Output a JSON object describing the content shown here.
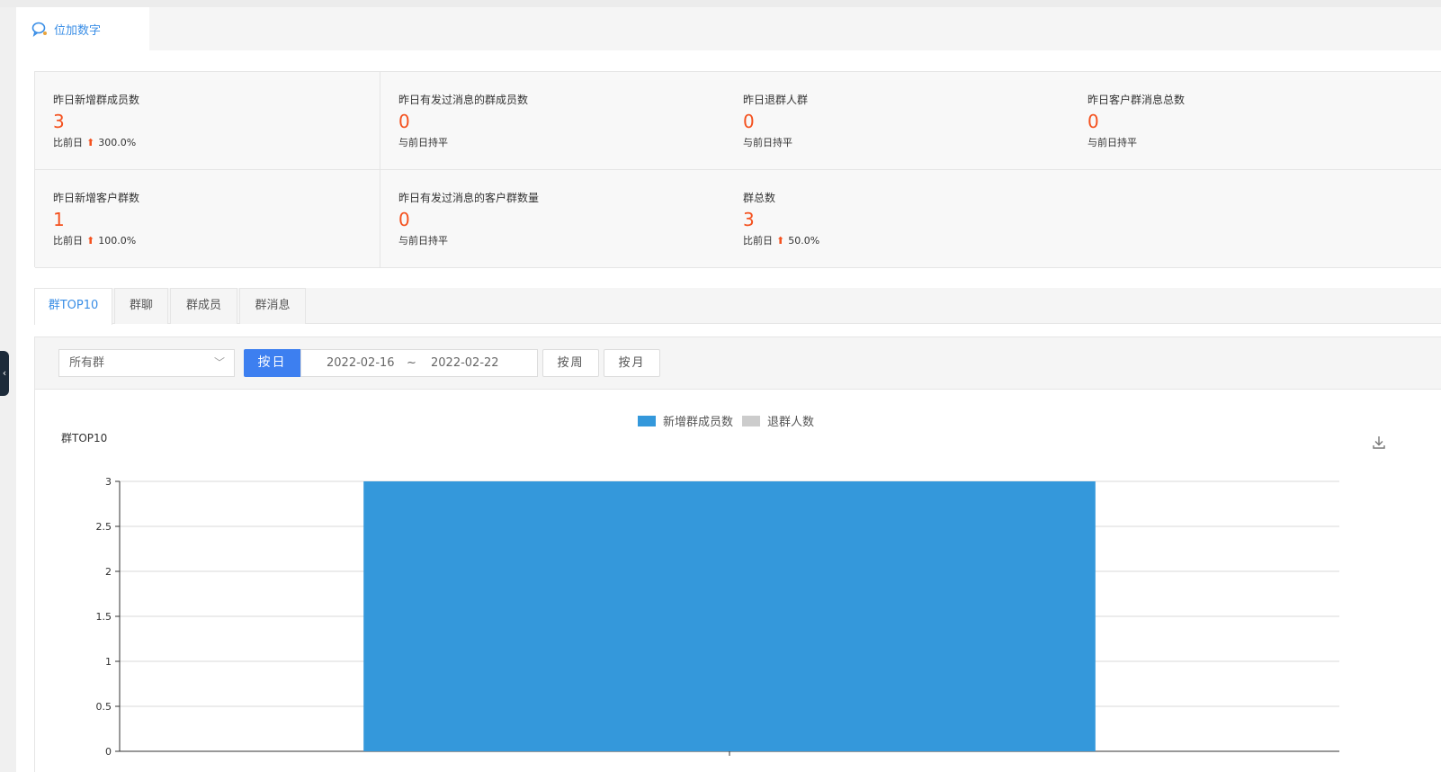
{
  "page_tab": {
    "label": "位加数字"
  },
  "stats": [
    {
      "label": "昨日新增群成员数",
      "value": "3",
      "change_prefix": "比前日",
      "change_value": "300.0%",
      "trend": "up"
    },
    {
      "label": "昨日有发过消息的群成员数",
      "value": "0",
      "change_text": "与前日持平"
    },
    {
      "label": "昨日退群人群",
      "value": "0",
      "change_text": "与前日持平"
    },
    {
      "label": "昨日客户群消息总数",
      "value": "0",
      "change_text": "与前日持平"
    },
    {
      "label": "昨日新增客户群数",
      "value": "1",
      "change_prefix": "比前日",
      "change_value": "100.0%",
      "trend": "up"
    },
    {
      "label": "昨日有发过消息的客户群数量",
      "value": "0",
      "change_text": "与前日持平"
    },
    {
      "label": "群总数",
      "value": "3",
      "change_prefix": "比前日",
      "change_value": "50.0%",
      "trend": "up"
    }
  ],
  "tabs": [
    {
      "label": "群TOP10",
      "active": true
    },
    {
      "label": "群聊",
      "active": false
    },
    {
      "label": "群成员",
      "active": false
    },
    {
      "label": "群消息",
      "active": false
    }
  ],
  "filter": {
    "group_select": "所有群",
    "by_day": "按日",
    "date_start": "2022-02-16",
    "date_sep": "~",
    "date_end": "2022-02-22",
    "by_week": "按周",
    "by_month": "按月"
  },
  "colors": {
    "accent": "#3d7ff0",
    "value": "#f4511e",
    "series1": "#3498db",
    "series2": "#cccccc"
  },
  "chart_data": {
    "type": "bar",
    "title": "群TOP10",
    "categories": [
      ""
    ],
    "series": [
      {
        "name": "新增群成员数",
        "values": [
          3
        ],
        "color": "#3498db"
      },
      {
        "name": "退群人数",
        "values": [
          0
        ],
        "color": "#cccccc"
      }
    ],
    "yticks": [
      "0",
      "0.5",
      "1",
      "1.5",
      "2",
      "2.5",
      "3"
    ],
    "ylim": [
      0,
      3
    ],
    "grid": true,
    "legend": "top-center"
  }
}
